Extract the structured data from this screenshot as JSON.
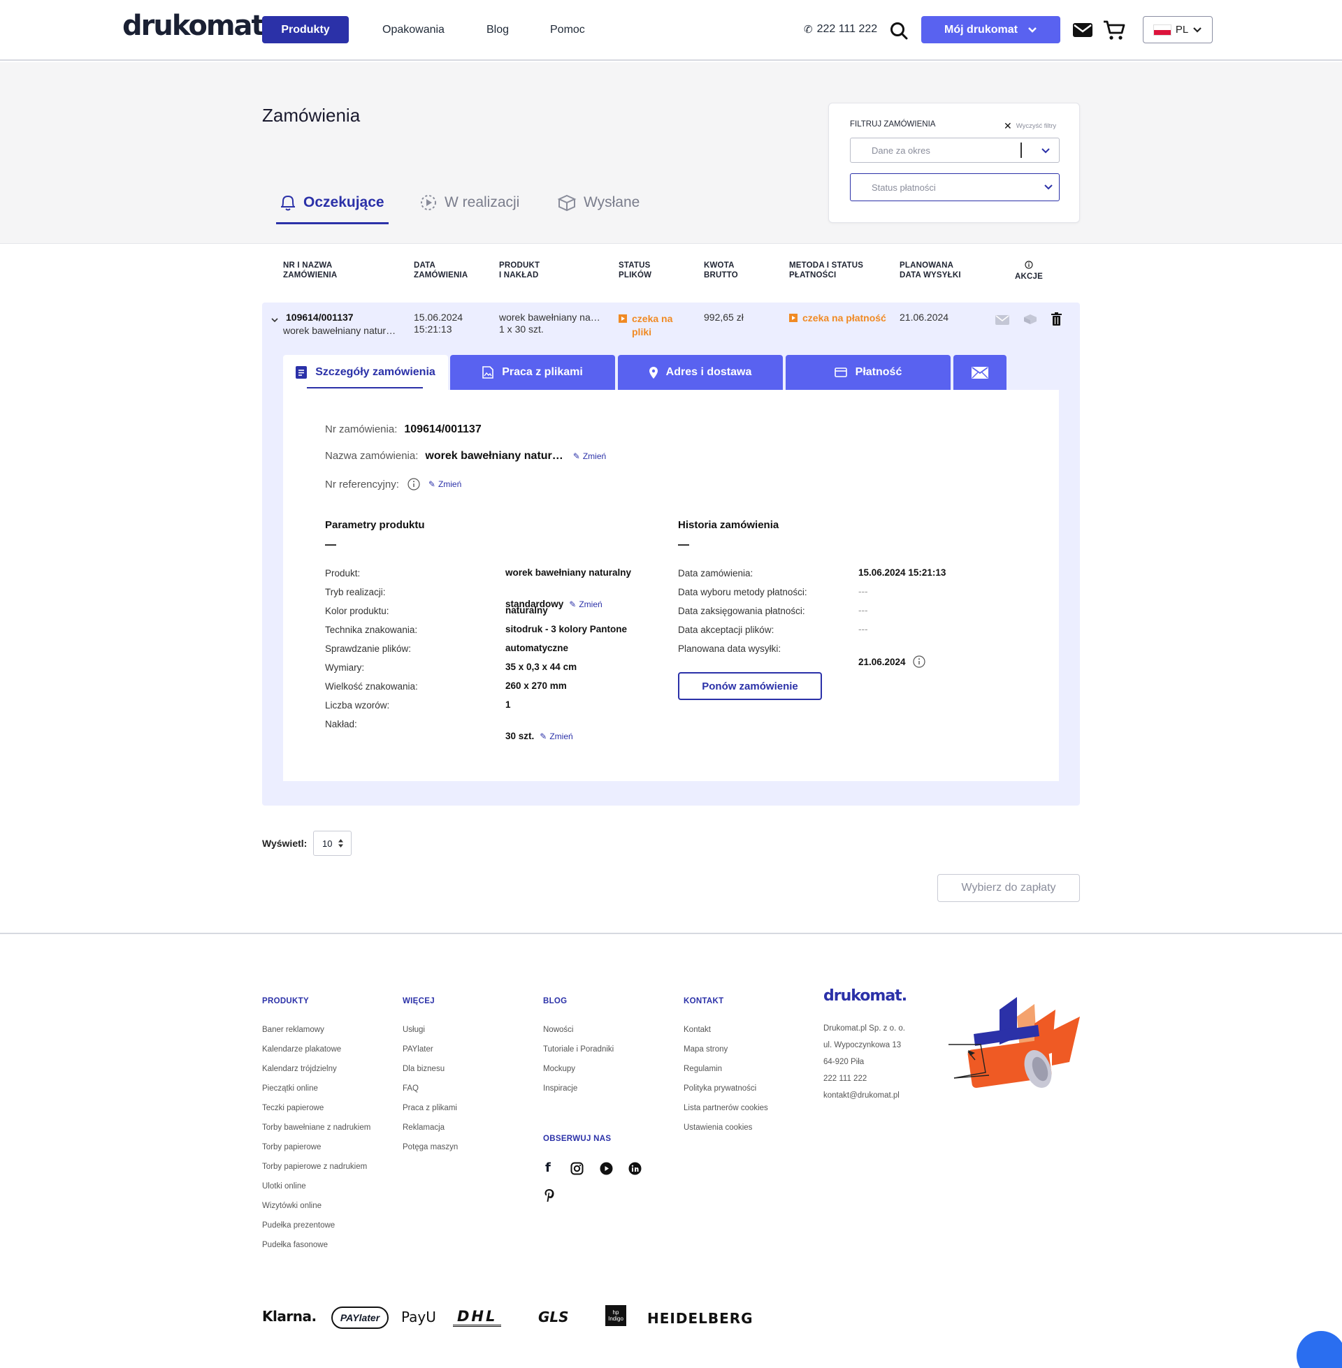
{
  "header": {
    "logo": "drukomat.",
    "nav": [
      "Produkty",
      "Opakowania",
      "Blog",
      "Pomoc"
    ],
    "phone": "222 111 222",
    "account_label": "Mój drukomat",
    "lang": "PL"
  },
  "page": {
    "title": "Zamówienia",
    "tabs": [
      "Oczekujące",
      "W realizacji",
      "Wysłane"
    ]
  },
  "filter": {
    "title": "FILTRUJ ZAMÓWIENIA",
    "clear": "Wyczyść filtry",
    "period_placeholder": "Dane za okres",
    "payment_placeholder": "Status płatności"
  },
  "table": {
    "headers": [
      [
        "NR I NAZWA",
        "ZAMÓWIENIA"
      ],
      [
        "DATA",
        "ZAMÓWIENIA"
      ],
      [
        "PRODUKT",
        "I NAKŁAD"
      ],
      [
        "STATUS",
        "PLIKÓW"
      ],
      [
        "KWOTA",
        "BRUTTO"
      ],
      [
        "METODA I STATUS",
        "PŁATNOŚCI"
      ],
      [
        "PLANOWANA",
        "DATA WYSYŁKI"
      ],
      [
        "AKCJE",
        ""
      ]
    ],
    "row": {
      "number": "109614/001137",
      "name": "worek bawełniany natur…",
      "date": "15.06.2024",
      "time": "15:21:13",
      "product": "worek bawełniany na…",
      "quantity": "1 x 30 szt.",
      "file_status_1": "czeka na",
      "file_status_2": "pliki",
      "amount": "992,65 zł",
      "payment_status": "czeka na płatność",
      "ship_date": "21.06.2024"
    }
  },
  "detail_tabs": [
    "Szczegóły zamówienia",
    "Praca z plikami",
    "Adres i dostawa",
    "Płatność"
  ],
  "detail": {
    "order_no_label": "Nr zamówienia:",
    "order_no": "109614/001137",
    "order_name_label": "Nazwa zamówienia:",
    "order_name": "worek bawełniany natur…",
    "ref_label": "Nr referencyjny:",
    "change": "Zmień",
    "params_title": "Parametry produktu",
    "params": [
      {
        "k": "Produkt:",
        "v": "worek bawełniany naturalny"
      },
      {
        "k": "Tryb realizacji:",
        "v": "standardowy"
      },
      {
        "k": "Kolor produktu:",
        "v": "naturalny"
      },
      {
        "k": "Technika znakowania:",
        "v": "sitodruk - 3 kolory Pantone"
      },
      {
        "k": "Sprawdzanie plików:",
        "v": "automatyczne"
      },
      {
        "k": "Wymiary:",
        "v": "35 x 0,3 x 44 cm"
      },
      {
        "k": "Wielkość znakowania:",
        "v": "260 x 270 mm"
      },
      {
        "k": "Liczba wzorów:",
        "v": "1"
      },
      {
        "k": "Nakład:",
        "v": "30 szt."
      }
    ],
    "history_title": "Historia zamówienia",
    "history": [
      {
        "k": "Data zamówienia:",
        "v": "15.06.2024 15:21:13"
      },
      {
        "k": "Data wyboru metody płatności:",
        "v": "---"
      },
      {
        "k": "Data zaksięgowania płatności:",
        "v": "---"
      },
      {
        "k": "Data akceptacji plików:",
        "v": "---"
      },
      {
        "k": "Planowana data wysyłki:",
        "v": "21.06.2024"
      }
    ],
    "reorder": "Ponów zamówienie"
  },
  "pagination": {
    "label": "Wyświetl:",
    "value": "10"
  },
  "pay_button": "Wybierz do zapłaty",
  "footer": {
    "col1_title": "PRODUKTY",
    "col1": [
      "Baner reklamowy",
      "Kalendarze plakatowe",
      "Kalendarz trójdzielny",
      "Pieczątki online",
      "Teczki papierowe",
      "Torby bawełniane z nadrukiem",
      "Torby papierowe",
      "Torby papierowe z nadrukiem",
      "Ulotki online",
      "Wizytówki online",
      "Pudełka prezentowe",
      "Pudełka fasonowe"
    ],
    "col2_title": "WIĘCEJ",
    "col2": [
      "Usługi",
      "PAYlater",
      "Dla biznesu",
      "FAQ",
      "Praca z plikami",
      "Reklamacja",
      "Potęga maszyn"
    ],
    "col3_title": "BLOG",
    "col3": [
      "Nowości",
      "Tutoriale i Poradniki",
      "Mockupy",
      "Inspiracje"
    ],
    "social_title": "OBSERWUJ NAS",
    "col4_title": "KONTAKT",
    "col4": [
      "Kontakt",
      "Mapa strony",
      "Regulamin",
      "Polityka prywatności",
      "Lista partnerów cookies",
      "Ustawienia cookies"
    ],
    "logo": "drukomat.",
    "address": [
      "Drukomat.pl Sp. z o. o.",
      "ul. Wypoczynkowa 13",
      "64-920 Piła",
      "222 111 222",
      "kontakt@drukomat.pl"
    ],
    "partners": [
      "Klarna.",
      "PAYlater",
      "PayU",
      "DHL",
      "GLS",
      "hp Indigo",
      "HEIDELBERG"
    ]
  },
  "colors": {
    "primary": "#2b31a8",
    "accent": "#5962f0",
    "warning": "#f08a24"
  }
}
